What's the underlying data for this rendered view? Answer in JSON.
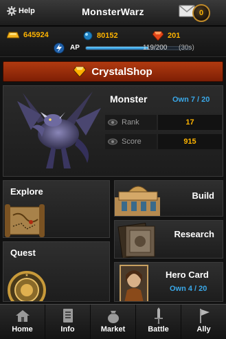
{
  "header": {
    "help_label": "Help",
    "title": "MonsterWarz",
    "mail_count": "0"
  },
  "resources": {
    "gold": "645924",
    "crystal": "80152",
    "ruby": "201",
    "ap_label": "AP",
    "ap_value": "119/200",
    "ap_timer": "(30s)",
    "ap_fraction": 0.595
  },
  "shop": {
    "label": "CrystalShop"
  },
  "monster": {
    "title": "Monster",
    "own": "Own 7 / 20",
    "rank_label": "Rank",
    "rank_value": "17",
    "score_label": "Score",
    "score_value": "915"
  },
  "tiles": {
    "explore": "Explore",
    "quest": "Quest",
    "build": "Build",
    "research": "Research",
    "hero_card": "Hero Card",
    "hero_own": "Own 4 / 20"
  },
  "nav": [
    {
      "label": "Home",
      "icon": "home-icon"
    },
    {
      "label": "Info",
      "icon": "info-icon"
    },
    {
      "label": "Market",
      "icon": "market-bag-icon"
    },
    {
      "label": "Battle",
      "icon": "sword-icon"
    },
    {
      "label": "Ally",
      "icon": "flag-icon"
    }
  ],
  "colors": {
    "gold_text": "#ffb400",
    "blue_text": "#3aa8e8",
    "shop_red": "#b13a10"
  }
}
